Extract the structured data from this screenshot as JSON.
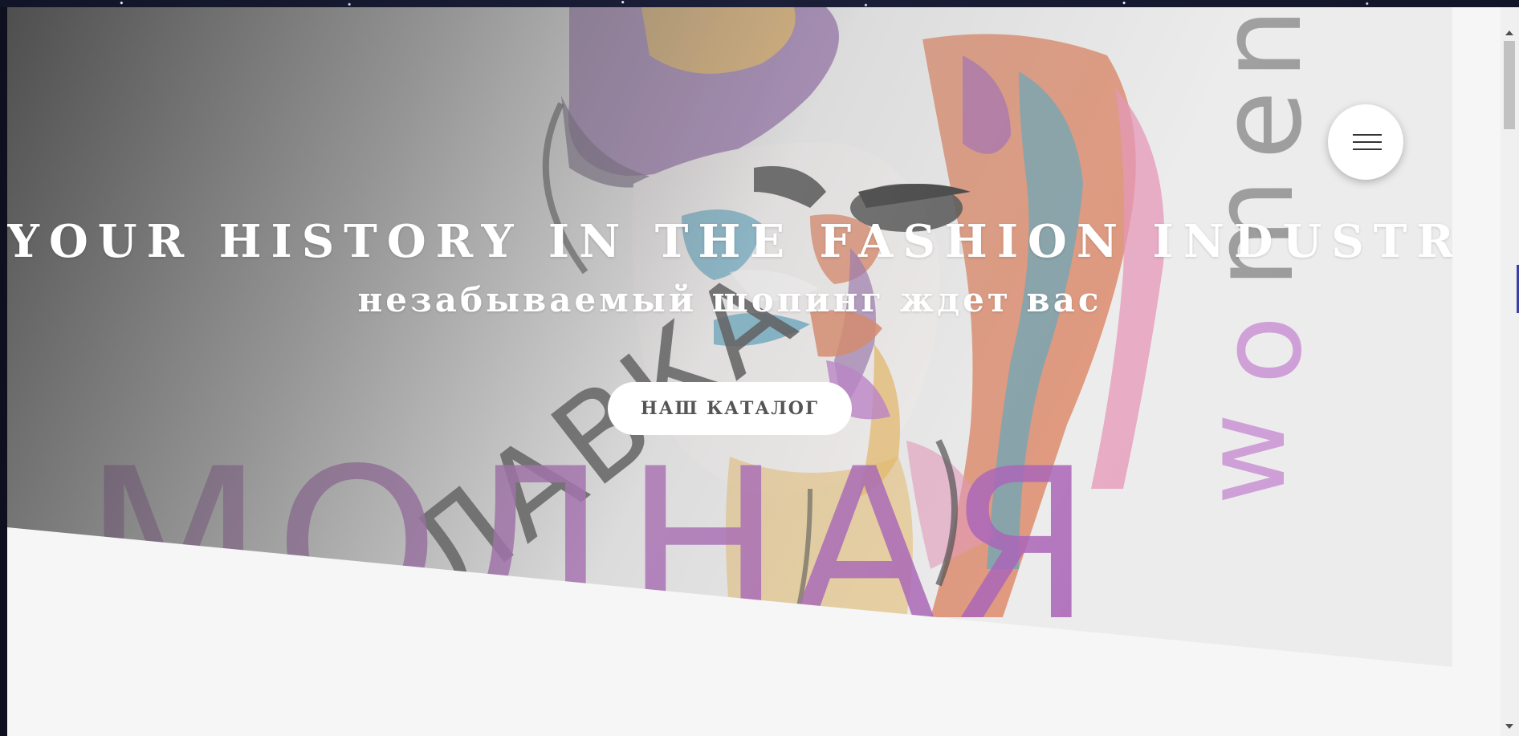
{
  "hero": {
    "title": "YOUR HISTORY IN THE FASHION INDUSTRY",
    "subtitle": "незабываемый шопинг ждет вас",
    "catalog_button": "НАШ КАТАЛОГ"
  },
  "brand_art": {
    "word_main": "МОДНАЯ",
    "word_small": "ЛАВКА",
    "word_vertical": "women"
  },
  "icons": {
    "menu": "hamburger-menu-icon"
  },
  "colors": {
    "accent_purple": "#b56bc4",
    "button_bg": "#ffffff",
    "title_text": "#ffffff",
    "page_bg": "#f6f6f6"
  }
}
